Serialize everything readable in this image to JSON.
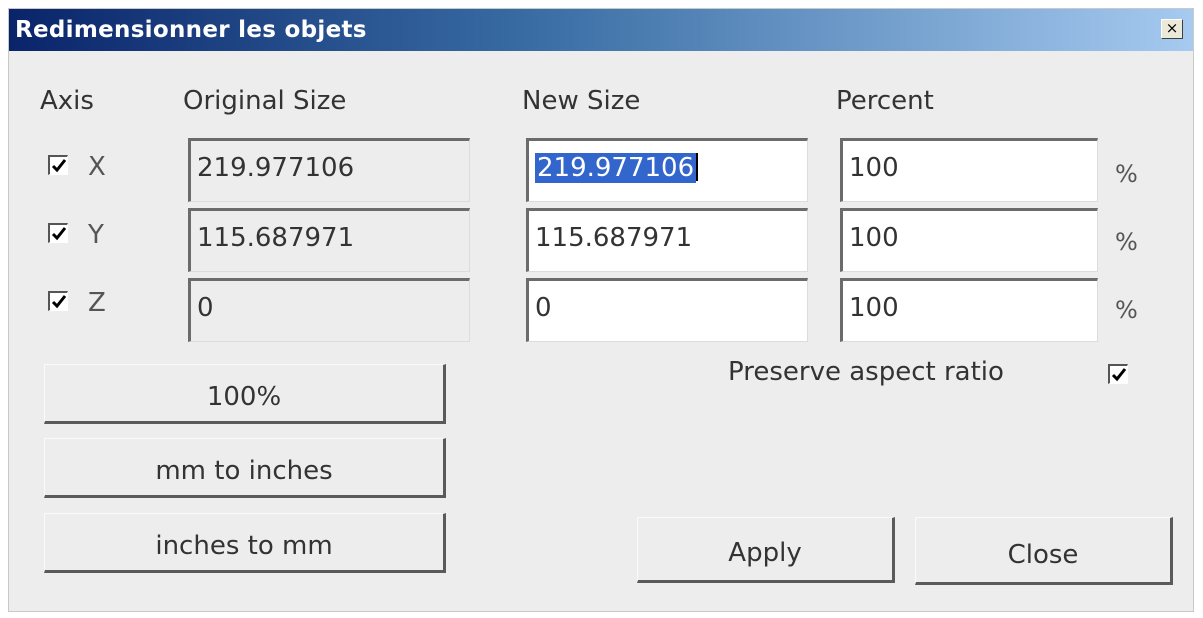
{
  "window": {
    "title": "Redimensionner les objets",
    "close_glyph": "×"
  },
  "headers": {
    "axis": "Axis",
    "original": "Original Size",
    "new": "New Size",
    "percent": "Percent"
  },
  "rows": [
    {
      "axis": "X",
      "checked": true,
      "original": "219.977106",
      "new": "219.977106",
      "percent": "100",
      "unit": "%"
    },
    {
      "axis": "Y",
      "checked": true,
      "original": "115.687971",
      "new": "115.687971",
      "percent": "100",
      "unit": "%"
    },
    {
      "axis": "Z",
      "checked": true,
      "original": "0",
      "new": "0",
      "percent": "100",
      "unit": "%"
    }
  ],
  "preserve_aspect": {
    "label": "Preserve aspect ratio",
    "checked": true
  },
  "buttons": {
    "hundred": "100%",
    "mm_to_inches": "mm to inches",
    "inches_to_mm": "inches to mm",
    "apply": "Apply",
    "close": "Close"
  },
  "icons": {
    "checkbox": "checkmark-icon",
    "close": "close-icon"
  }
}
